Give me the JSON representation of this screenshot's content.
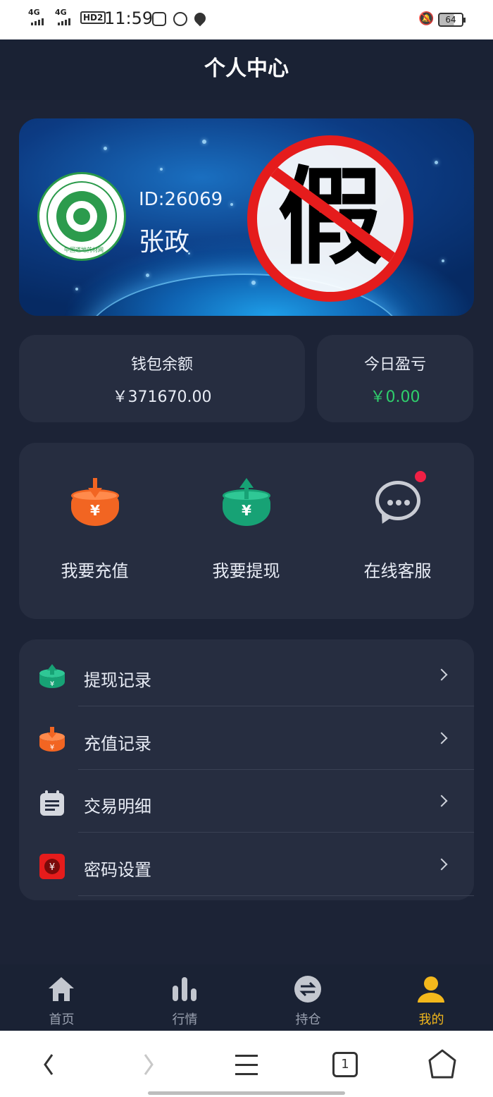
{
  "status_bar": {
    "network1": "4G",
    "network2": "4G",
    "hd": "HD2",
    "time": "11:59",
    "battery": "64"
  },
  "page_title": "个人中心",
  "profile": {
    "id_text": "ID:26069",
    "name": "张政",
    "logo_text": "中国道地药材网",
    "fake_mark_text": "假"
  },
  "wallet": {
    "label": "钱包余额",
    "value": "￥371670.00"
  },
  "pnl": {
    "label": "今日盈亏",
    "value": "￥0.00",
    "value_color": "#2fcf6c"
  },
  "actions": [
    {
      "label": "我要充值",
      "icon": "deposit-icon"
    },
    {
      "label": "我要提现",
      "icon": "withdraw-icon"
    },
    {
      "label": "在线客服",
      "icon": "chat-icon"
    }
  ],
  "menu": [
    {
      "label": "提现记录",
      "icon": "withdraw-record-icon"
    },
    {
      "label": "充值记录",
      "icon": "deposit-record-icon"
    },
    {
      "label": "交易明细",
      "icon": "clipboard-icon"
    },
    {
      "label": "密码设置",
      "icon": "lock-yen-icon"
    }
  ],
  "tabs": [
    {
      "label": "首页",
      "icon": "home-icon"
    },
    {
      "label": "行情",
      "icon": "bar-chart-icon"
    },
    {
      "label": "持仓",
      "icon": "swap-icon"
    },
    {
      "label": "我的",
      "icon": "user-icon",
      "active": true
    }
  ],
  "browser": {
    "tab_count": "1"
  },
  "colors": {
    "background": "#1c2336",
    "card": "#262d40",
    "accent": "#f3b81c",
    "deposit_orange": "#f26522",
    "withdraw_green": "#17a275",
    "alert_red": "#e51c1c"
  }
}
